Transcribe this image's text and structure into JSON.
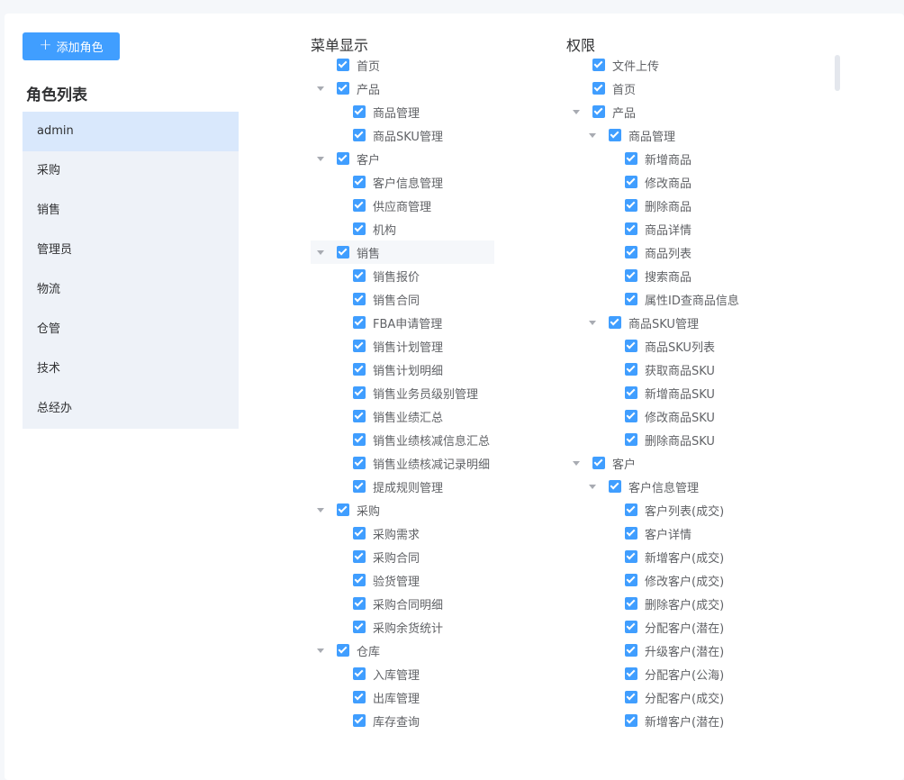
{
  "add_button_label": "添加角色",
  "role_list_title": "角色列表",
  "roles": [
    "admin",
    "采购",
    "销售",
    "管理员",
    "物流",
    "仓管",
    "技术",
    "总经办"
  ],
  "active_role": "admin",
  "menu_title": "菜单显示",
  "perm_title": "权限",
  "accent_color": "#409eff",
  "menu_tree": [
    {
      "label": "首页",
      "level": 0,
      "expandable": false
    },
    {
      "label": "产品",
      "level": 0,
      "expandable": true
    },
    {
      "label": "商品管理",
      "level": 1,
      "expandable": false
    },
    {
      "label": "商品SKU管理",
      "level": 1,
      "expandable": false
    },
    {
      "label": "客户",
      "level": 0,
      "expandable": true
    },
    {
      "label": "客户信息管理",
      "level": 1,
      "expandable": false
    },
    {
      "label": "供应商管理",
      "level": 1,
      "expandable": false
    },
    {
      "label": "机构",
      "level": 1,
      "expandable": false
    },
    {
      "label": "销售",
      "level": 0,
      "expandable": true,
      "highlight": true
    },
    {
      "label": "销售报价",
      "level": 1,
      "expandable": false
    },
    {
      "label": "销售合同",
      "level": 1,
      "expandable": false
    },
    {
      "label": "FBA申请管理",
      "level": 1,
      "expandable": false
    },
    {
      "label": "销售计划管理",
      "level": 1,
      "expandable": false
    },
    {
      "label": "销售计划明细",
      "level": 1,
      "expandable": false
    },
    {
      "label": "销售业务员级别管理",
      "level": 1,
      "expandable": false
    },
    {
      "label": "销售业绩汇总",
      "level": 1,
      "expandable": false
    },
    {
      "label": "销售业绩核减信息汇总",
      "level": 1,
      "expandable": false
    },
    {
      "label": "销售业绩核减记录明细",
      "level": 1,
      "expandable": false
    },
    {
      "label": "提成规则管理",
      "level": 1,
      "expandable": false
    },
    {
      "label": "采购",
      "level": 0,
      "expandable": true
    },
    {
      "label": "采购需求",
      "level": 1,
      "expandable": false
    },
    {
      "label": "采购合同",
      "level": 1,
      "expandable": false
    },
    {
      "label": "验货管理",
      "level": 1,
      "expandable": false
    },
    {
      "label": "采购合同明细",
      "level": 1,
      "expandable": false
    },
    {
      "label": "采购余货统计",
      "level": 1,
      "expandable": false
    },
    {
      "label": "仓库",
      "level": 0,
      "expandable": true
    },
    {
      "label": "入库管理",
      "level": 1,
      "expandable": false
    },
    {
      "label": "出库管理",
      "level": 1,
      "expandable": false
    },
    {
      "label": "库存查询",
      "level": 1,
      "expandable": false
    }
  ],
  "perm_tree": [
    {
      "label": "文件上传",
      "level": 0,
      "expandable": false
    },
    {
      "label": "首页",
      "level": 0,
      "expandable": false
    },
    {
      "label": "产品",
      "level": 0,
      "expandable": true
    },
    {
      "label": "商品管理",
      "level": 1,
      "expandable": true
    },
    {
      "label": "新增商品",
      "level": 2,
      "expandable": false
    },
    {
      "label": "修改商品",
      "level": 2,
      "expandable": false
    },
    {
      "label": "删除商品",
      "level": 2,
      "expandable": false
    },
    {
      "label": "商品详情",
      "level": 2,
      "expandable": false
    },
    {
      "label": "商品列表",
      "level": 2,
      "expandable": false
    },
    {
      "label": "搜索商品",
      "level": 2,
      "expandable": false
    },
    {
      "label": "属性ID查商品信息",
      "level": 2,
      "expandable": false
    },
    {
      "label": "商品SKU管理",
      "level": 1,
      "expandable": true
    },
    {
      "label": "商品SKU列表",
      "level": 2,
      "expandable": false
    },
    {
      "label": "获取商品SKU",
      "level": 2,
      "expandable": false
    },
    {
      "label": "新增商品SKU",
      "level": 2,
      "expandable": false
    },
    {
      "label": "修改商品SKU",
      "level": 2,
      "expandable": false
    },
    {
      "label": "删除商品SKU",
      "level": 2,
      "expandable": false
    },
    {
      "label": "客户",
      "level": 0,
      "expandable": true
    },
    {
      "label": "客户信息管理",
      "level": 1,
      "expandable": true
    },
    {
      "label": "客户列表(成交)",
      "level": 2,
      "expandable": false
    },
    {
      "label": "客户详情",
      "level": 2,
      "expandable": false
    },
    {
      "label": "新增客户(成交)",
      "level": 2,
      "expandable": false
    },
    {
      "label": "修改客户(成交)",
      "level": 2,
      "expandable": false
    },
    {
      "label": "删除客户(成交)",
      "level": 2,
      "expandable": false
    },
    {
      "label": "分配客户(潜在)",
      "level": 2,
      "expandable": false
    },
    {
      "label": "升级客户(潜在)",
      "level": 2,
      "expandable": false
    },
    {
      "label": "分配客户(公海)",
      "level": 2,
      "expandable": false
    },
    {
      "label": "分配客户(成交)",
      "level": 2,
      "expandable": false
    },
    {
      "label": "新增客户(潜在)",
      "level": 2,
      "expandable": false
    }
  ]
}
